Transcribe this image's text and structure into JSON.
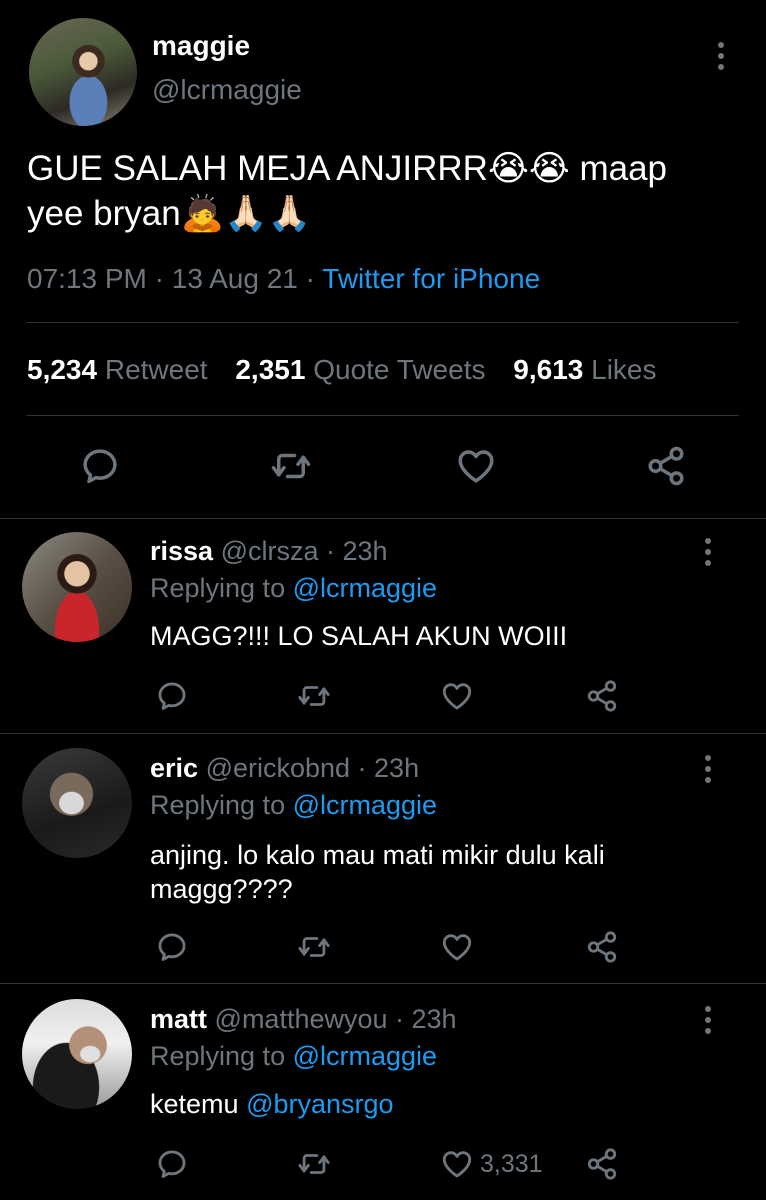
{
  "main_tweet": {
    "name": "maggie",
    "handle": "@lcrmaggie",
    "text_line1": "GUE SALAH MEJA ANJIRRR😭😭 maap",
    "text_line2": "yee bryan🙇🙏🏻🙏🏻",
    "time": "07:13 PM",
    "sep": "·",
    "date": "13 Aug 21",
    "sep2": "·",
    "source": "Twitter for iPhone",
    "stats": {
      "retweets_count": "5,234",
      "retweets_label": "Retweet",
      "quotes_count": "2,351",
      "quotes_label": "Quote Tweets",
      "likes_count": "9,613",
      "likes_label": "Likes"
    }
  },
  "replies": [
    {
      "name": "rissa",
      "handle_time": "@clrsza · 23h",
      "replying_prefix": "Replying to",
      "replying_handle": "@lcrmaggie",
      "text": "MAGG?!!! LO SALAH AKUN WOIII"
    },
    {
      "name": "eric",
      "handle_time": "@erickobnd · 23h",
      "replying_prefix": "Replying to",
      "replying_handle": "@lcrmaggie",
      "text_line1": "anjing. lo kalo mau mati mikir dulu kali",
      "text_line2": "maggg????"
    },
    {
      "name": "matt",
      "handle_time": "@matthewyou · 23h",
      "replying_prefix": "Replying to",
      "replying_handle": "@lcrmaggie",
      "text_prefix": "ketemu",
      "mention": "@bryansrgo",
      "like_count": "3,331"
    }
  ],
  "colors": {
    "background": "#000000",
    "text": "#d9d9d9",
    "secondary": "#6e767d",
    "link": "#1d9bf0",
    "divider": "#2f3336"
  },
  "icons": [
    "more-icon",
    "reply-icon",
    "retweet-icon",
    "like-icon",
    "share-icon"
  ]
}
